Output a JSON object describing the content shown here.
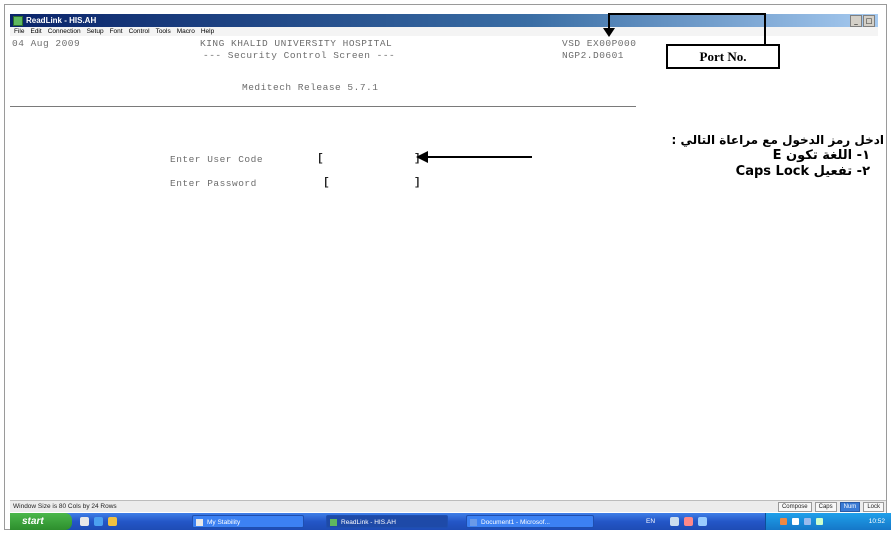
{
  "window": {
    "title": "ReadLink - HIS.AH",
    "buttons": [
      "_",
      "□"
    ]
  },
  "menu": {
    "items": [
      "File",
      "Edit",
      "Connection",
      "Setup",
      "Font",
      "Control",
      "Tools",
      "Macro",
      "Help"
    ]
  },
  "terminal": {
    "date": "04 Aug 2009",
    "hospital": "KING KHALID UNIVERSITY HOSPITAL",
    "screen_title": "--- Security Control Screen ---",
    "release": "Meditech Release 5.7.1",
    "terminal_code": "VSD EX00P000",
    "port_code": "NGP2.D0601",
    "user_code_label": "Enter User Code",
    "password_label": "Enter Password",
    "open_bracket": "[",
    "close_bracket": "]"
  },
  "annotation": {
    "port_label": "Port No.",
    "instruction": "ادخل رمز الدخول مع مراعاة التالي :",
    "item1": "١-   اللغة تكون E",
    "item2": "٢-   تفعيل Caps Lock"
  },
  "statusbar": {
    "text": "Window Size is 80 Cols by 24 Rows",
    "panels": [
      "Compose",
      "Caps",
      "Num",
      "Lock"
    ],
    "active_panel_color": "#3a7bd5"
  },
  "taskbar": {
    "start_label": "start",
    "tasks": [
      "My Stability",
      "ReadLink - HIS.AH",
      "Document1 - Microsof..."
    ],
    "language": "EN",
    "clock": "10:52"
  }
}
